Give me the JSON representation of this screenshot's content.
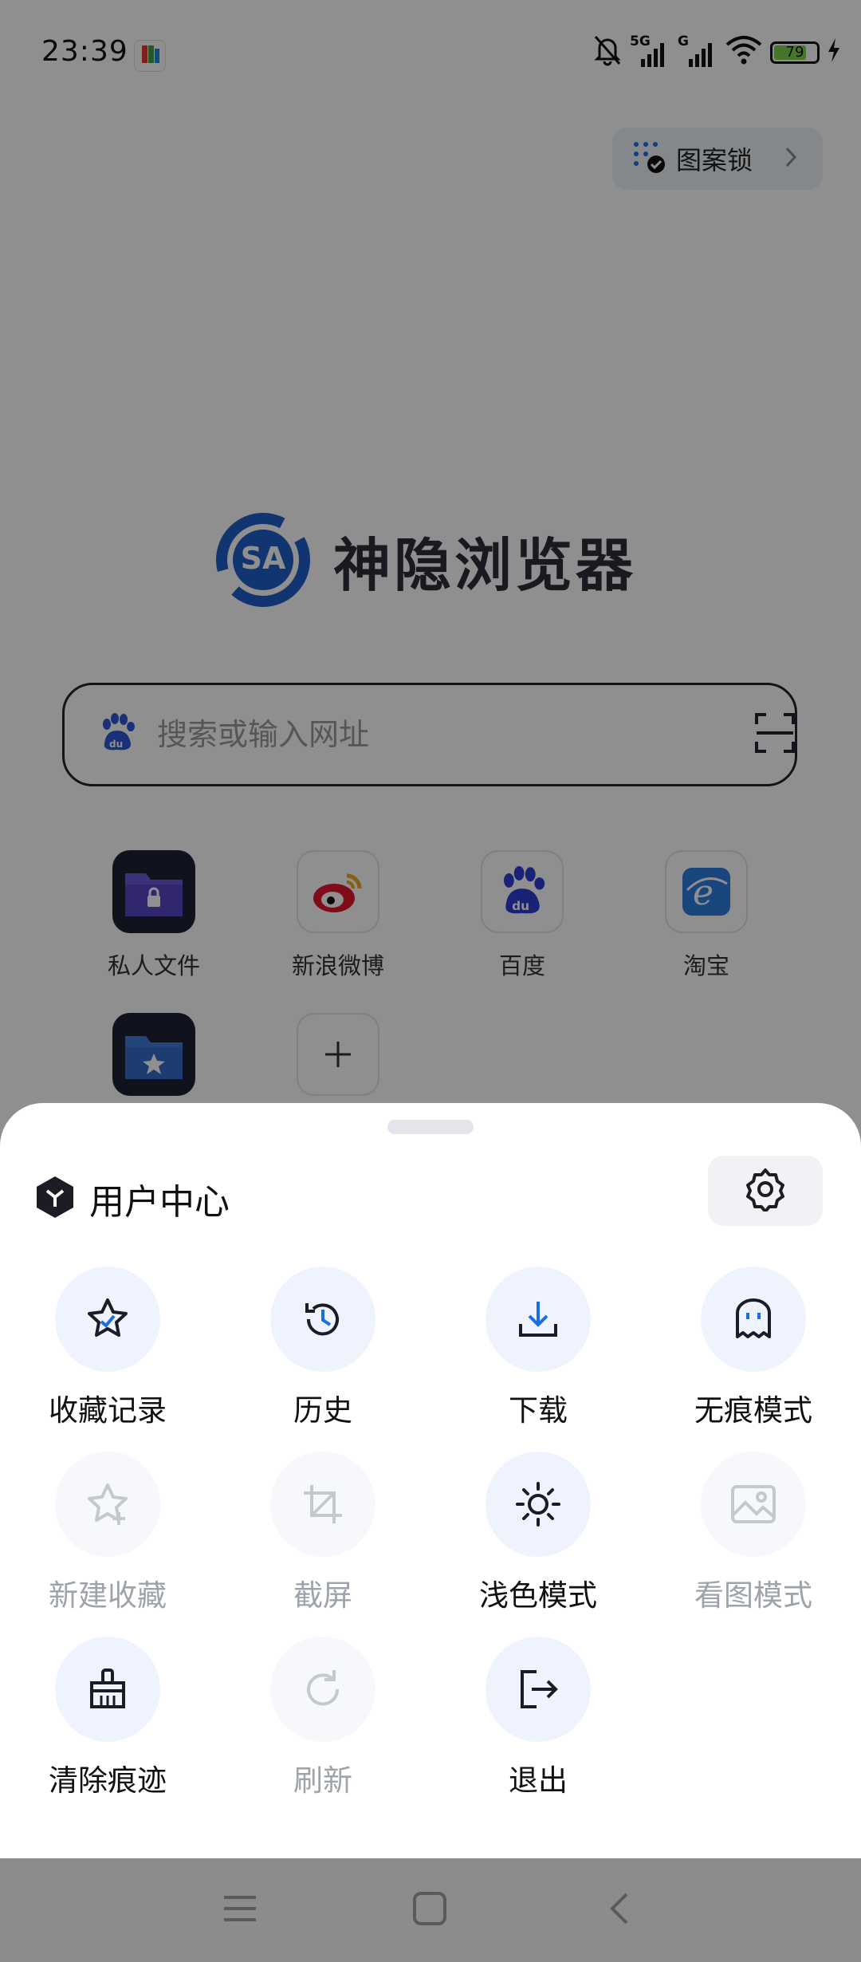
{
  "status_bar": {
    "time": "23:39",
    "network_5g": "5G",
    "network_g": "G",
    "battery": "79",
    "icons": [
      "app-downloader-icon",
      "mute-bell-icon",
      "signal-5g-icon",
      "signal-g-icon",
      "wifi-icon",
      "battery-icon",
      "charging-icon"
    ]
  },
  "pattern_lock": {
    "label": "图案锁"
  },
  "logo": {
    "badge": "SA",
    "name": "神隐浏览器"
  },
  "search": {
    "placeholder": "搜索或输入网址"
  },
  "shortcuts": [
    {
      "label": "私人文件"
    },
    {
      "label": "新浪微博"
    },
    {
      "label": "百度"
    },
    {
      "label": "淘宝"
    }
  ],
  "sheet": {
    "title": "用户中心",
    "items": [
      {
        "label": "收藏记录",
        "icon": "star-check-icon",
        "enabled": true
      },
      {
        "label": "历史",
        "icon": "history-icon",
        "enabled": true
      },
      {
        "label": "下载",
        "icon": "download-icon",
        "enabled": true
      },
      {
        "label": "无痕模式",
        "icon": "ghost-icon",
        "enabled": true
      },
      {
        "label": "新建收藏",
        "icon": "star-plus-icon",
        "enabled": false
      },
      {
        "label": "截屏",
        "icon": "crop-icon",
        "enabled": false
      },
      {
        "label": "浅色模式",
        "icon": "sun-icon",
        "enabled": true
      },
      {
        "label": "看图模式",
        "icon": "image-icon",
        "enabled": false
      },
      {
        "label": "清除痕迹",
        "icon": "broom-icon",
        "enabled": true
      },
      {
        "label": "刷新",
        "icon": "refresh-icon",
        "enabled": false
      },
      {
        "label": "退出",
        "icon": "exit-icon",
        "enabled": true
      }
    ]
  },
  "colors": {
    "accent": "#1a6fe0",
    "logo_blue": "#1f5fc9",
    "sheet_icon_bg": "#eef3fd",
    "disabled": "#9ea3ab"
  }
}
